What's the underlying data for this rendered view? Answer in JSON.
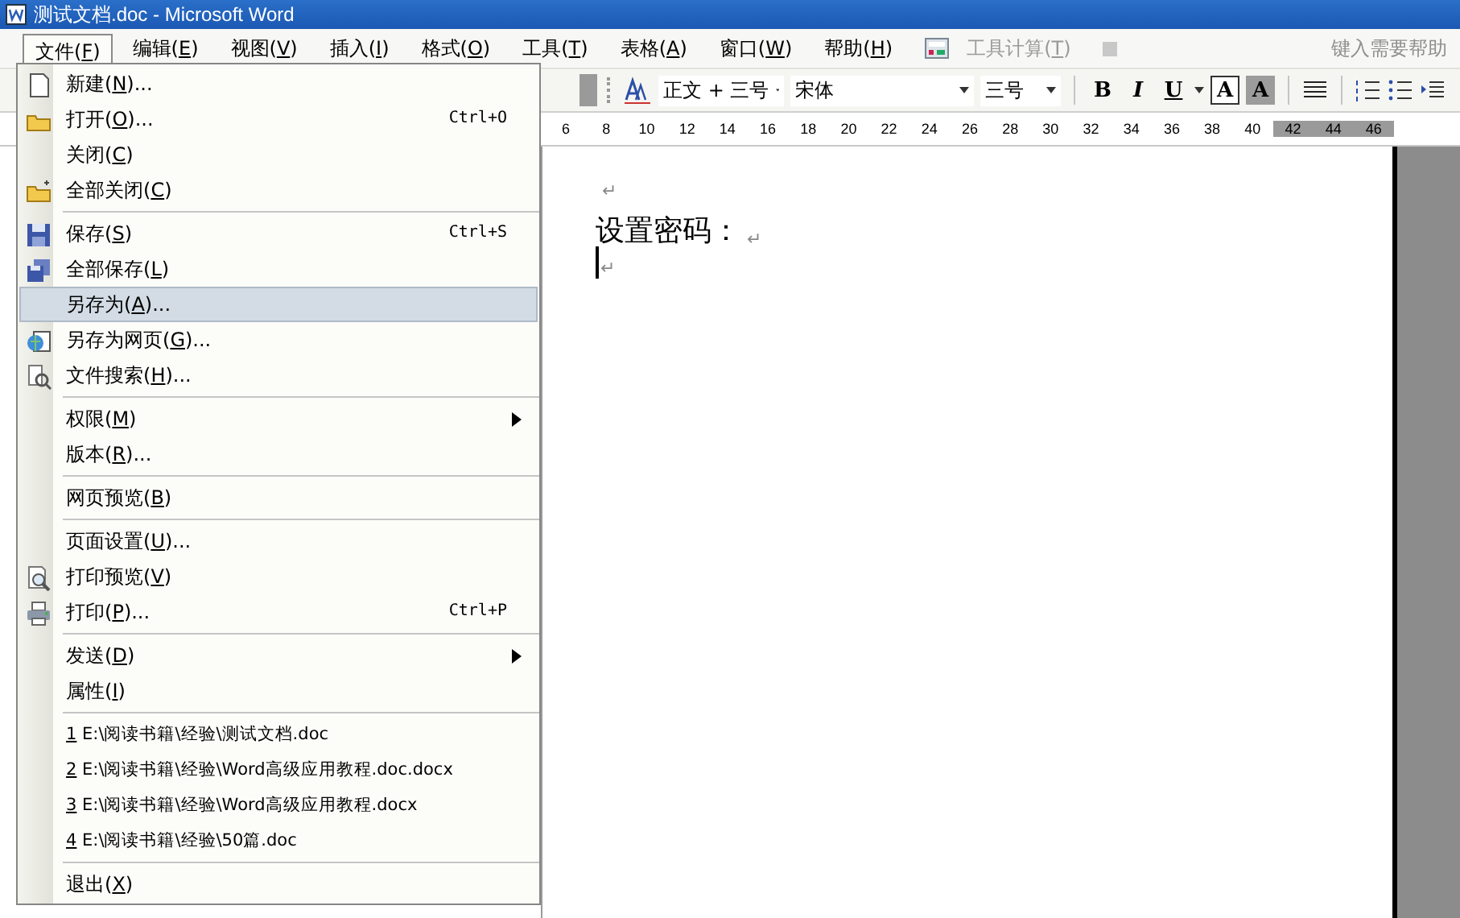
{
  "window": {
    "title": "测试文档.doc - Microsoft Word"
  },
  "menu_bar": {
    "items": [
      {
        "pre": "文件(",
        "key": "F",
        "post": ")",
        "selected": true,
        "disabled": false
      },
      {
        "pre": "编辑(",
        "key": "E",
        "post": ")",
        "selected": false,
        "disabled": false
      },
      {
        "pre": "视图(",
        "key": "V",
        "post": ")",
        "selected": false,
        "disabled": false
      },
      {
        "pre": "插入(",
        "key": "I",
        "post": ")",
        "selected": false,
        "disabled": false
      },
      {
        "pre": "格式(",
        "key": "O",
        "post": ")",
        "selected": false,
        "disabled": false
      },
      {
        "pre": "工具(",
        "key": "T",
        "post": ")",
        "selected": false,
        "disabled": false
      },
      {
        "pre": "表格(",
        "key": "A",
        "post": ")",
        "selected": false,
        "disabled": false
      },
      {
        "pre": "窗口(",
        "key": "W",
        "post": ")",
        "selected": false,
        "disabled": false
      },
      {
        "pre": "帮助(",
        "key": "H",
        "post": ")",
        "selected": false,
        "disabled": false
      },
      {
        "pre": "工具计算(",
        "key": "T",
        "post": ")",
        "selected": false,
        "disabled": true
      }
    ],
    "help_box": {
      "placeholder": "键入需要帮助"
    }
  },
  "toolbar": {
    "style": "正文 + 三号",
    "font": "宋体",
    "size": "三号",
    "buttons": [
      {
        "kind": "bold",
        "label": "B"
      },
      {
        "kind": "italic",
        "label": "I"
      },
      {
        "kind": "underline",
        "label": "U"
      },
      {
        "kind": "border",
        "label": "A"
      },
      {
        "kind": "shade",
        "label": "A"
      }
    ]
  },
  "ruler": {
    "ticks": [
      "6",
      "8",
      "10",
      "12",
      "14",
      "16",
      "18",
      "20",
      "22",
      "24",
      "26",
      "28",
      "30",
      "32",
      "34",
      "36",
      "38",
      "40",
      "42",
      "44",
      "46"
    ]
  },
  "document": {
    "paragraphs": [
      {
        "mark": "↵",
        "caret": false
      },
      {
        "text": "设置密码：",
        "mark": "↵",
        "caret": false
      },
      {
        "mark": "↵",
        "caret": true
      }
    ]
  },
  "file_menu": {
    "entries": [
      {
        "kind": "item",
        "pre": "新建(",
        "key": "N",
        "post": ")...",
        "selected": false
      },
      {
        "kind": "item",
        "pre": "打开(",
        "key": "O",
        "post": ")...",
        "shortcut": "Ctrl+O",
        "selected": false
      },
      {
        "kind": "item",
        "pre": "关闭(",
        "key": "C",
        "post": ")",
        "selected": false
      },
      {
        "kind": "item",
        "pre": "全部关闭(",
        "key": "C",
        "post": ")",
        "selected": false
      },
      {
        "kind": "separator"
      },
      {
        "kind": "item",
        "pre": "保存(",
        "key": "S",
        "post": ")",
        "shortcut": "Ctrl+S",
        "selected": false
      },
      {
        "kind": "item",
        "pre": "全部保存(",
        "key": "L",
        "post": ")",
        "selected": false
      },
      {
        "kind": "item",
        "pre": "另存为(",
        "key": "A",
        "post": ")...",
        "selected": true
      },
      {
        "kind": "item",
        "pre": "另存为网页(",
        "key": "G",
        "post": ")...",
        "selected": false
      },
      {
        "kind": "item",
        "pre": "文件搜索(",
        "key": "H",
        "post": ")...",
        "selected": false
      },
      {
        "kind": "separator"
      },
      {
        "kind": "item",
        "pre": "权限(",
        "key": "M",
        "post": ")",
        "submenu": true,
        "selected": false
      },
      {
        "kind": "item",
        "pre": "版本(",
        "key": "R",
        "post": ")...",
        "selected": false
      },
      {
        "kind": "separator"
      },
      {
        "kind": "item",
        "pre": "网页预览(",
        "key": "B",
        "post": ")",
        "selected": false
      },
      {
        "kind": "separator"
      },
      {
        "kind": "item",
        "pre": "页面设置(",
        "key": "U",
        "post": ")...",
        "selected": false
      },
      {
        "kind": "item",
        "pre": "打印预览(",
        "key": "V",
        "post": ")",
        "selected": false
      },
      {
        "kind": "item",
        "pre": "打印(",
        "key": "P",
        "post": ")...",
        "shortcut": "Ctrl+P",
        "selected": false
      },
      {
        "kind": "separator"
      },
      {
        "kind": "item",
        "pre": "发送(",
        "key": "D",
        "post": ")",
        "submenu": true,
        "selected": false
      },
      {
        "kind": "item",
        "pre": "属性(",
        "key": "I",
        "post": ")",
        "selected": false
      },
      {
        "kind": "separator"
      },
      {
        "kind": "recent",
        "key": "1",
        "post": " E:\\阅读书籍\\经验\\测试文档.doc",
        "selected": false
      },
      {
        "kind": "recent",
        "key": "2",
        "post": " E:\\阅读书籍\\经验\\Word高级应用教程.doc.docx",
        "selected": false
      },
      {
        "kind": "recent",
        "key": "3",
        "post": " E:\\阅读书籍\\经验\\Word高级应用教程.docx",
        "selected": false
      },
      {
        "kind": "recent",
        "key": "4",
        "post": " E:\\阅读书籍\\经验\\50篇.doc",
        "selected": false
      },
      {
        "kind": "separator"
      },
      {
        "kind": "item",
        "pre": "退出(",
        "key": "X",
        "post": ")",
        "selected": false
      }
    ]
  }
}
